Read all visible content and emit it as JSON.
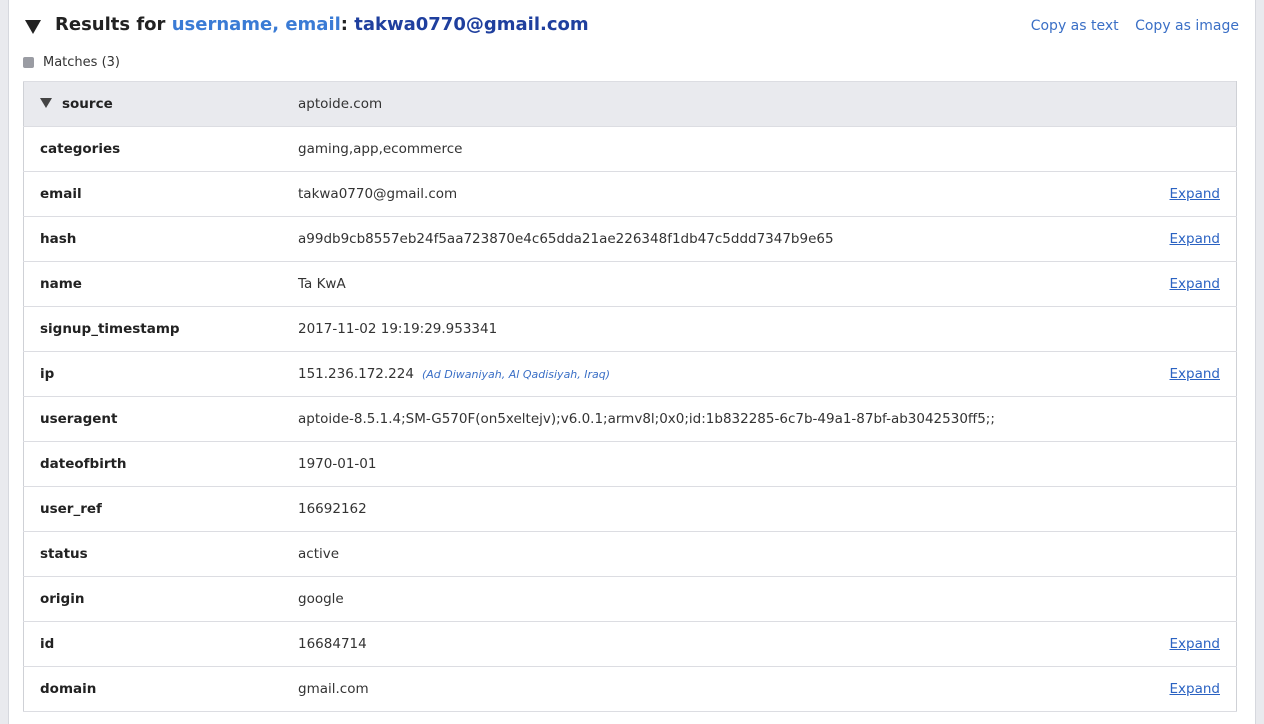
{
  "header": {
    "prefix": "Results for ",
    "query_fields": "username, email",
    "separator": ": ",
    "query_value": "takwa0770@gmail.com",
    "copy_text_label": "Copy as text",
    "copy_image_label": "Copy as image"
  },
  "matches": {
    "label": "Matches (3)"
  },
  "record": {
    "source_key": "source",
    "source_value": "aptoide.com",
    "expand_label": "Expand",
    "rows": [
      {
        "key": "categories",
        "value": "gaming,app,ecommerce"
      },
      {
        "key": "email",
        "value": "takwa0770@gmail.com"
      },
      {
        "key": "hash",
        "value": "a99db9cb8557eb24f5aa723870e4c65dda21ae226348f1db47c5ddd7347b9e65"
      },
      {
        "key": "name",
        "value": "Ta KwA"
      },
      {
        "key": "signup_timestamp",
        "value": "2017-11-02 19:19:29.953341"
      },
      {
        "key": "ip",
        "value": "151.236.172.224",
        "geo": "(Ad Diwaniyah, Al Qadisiyah, Iraq)"
      },
      {
        "key": "useragent",
        "value": "aptoide-8.5.1.4;SM-G570F(on5xeltejv);v6.0.1;armv8l;0x0;id:1b832285-6c7b-49a1-87bf-ab3042530ff5;;"
      },
      {
        "key": "dateofbirth",
        "value": "1970-01-01"
      },
      {
        "key": "user_ref",
        "value": "16692162"
      },
      {
        "key": "status",
        "value": "active"
      },
      {
        "key": "origin",
        "value": "google"
      },
      {
        "key": "id",
        "value": "16684714"
      },
      {
        "key": "domain",
        "value": "gmail.com"
      }
    ]
  }
}
